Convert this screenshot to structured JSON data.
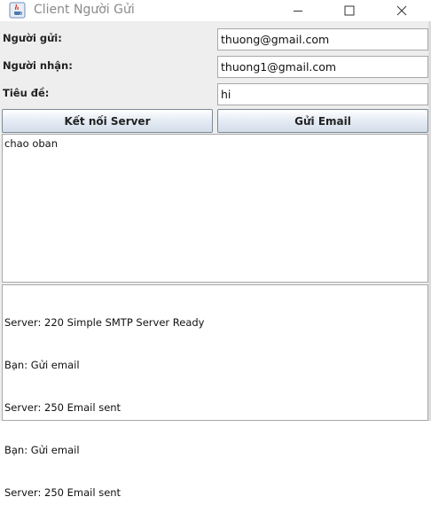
{
  "window": {
    "title": "Client Người Gửi",
    "icon": "java-coffee-icon",
    "controls": [
      "minimize-icon",
      "maximize-icon",
      "close-icon"
    ]
  },
  "form": {
    "sender_label": "Người gửi:",
    "sender_value": "thuong@gmail.com",
    "receiver_label": "Người nhận:",
    "receiver_value": "thuong1@gmail.com",
    "subject_label": "Tiêu đề:",
    "subject_value": "hi"
  },
  "buttons": {
    "connect_label": "Kết nối Server",
    "send_label": "Gửi Email"
  },
  "body_text": "chao oban",
  "log": {
    "lines": [
      "Server: 220 Simple SMTP Server Ready",
      "Bạn: Gửi email",
      "Server: 250 Email sent",
      "Bạn: Gửi email",
      "Server: 250 Email sent"
    ]
  }
}
